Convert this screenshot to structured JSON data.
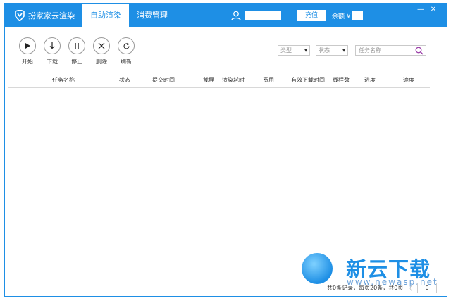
{
  "app": {
    "title": "扮家家云渲染",
    "tabs": [
      {
        "label": "自助渲染",
        "active": true
      },
      {
        "label": "消费管理",
        "active": false
      }
    ],
    "recharge_label": "充值",
    "balance_label": "余额 ¥ :"
  },
  "toolbar": {
    "buttons": [
      {
        "label": "开始",
        "icon": "play-icon"
      },
      {
        "label": "下载",
        "icon": "download-icon"
      },
      {
        "label": "停止",
        "icon": "pause-icon"
      },
      {
        "label": "删除",
        "icon": "close-icon"
      },
      {
        "label": "刷新",
        "icon": "refresh-icon"
      }
    ],
    "filters": {
      "type": "类型",
      "status": "状态",
      "search_placeholder": "任务名称"
    }
  },
  "table": {
    "columns": [
      "任务名称",
      "状态",
      "提交时间",
      "截屏",
      "渲染耗时",
      "费用",
      "有效下载时间",
      "线程数",
      "进度",
      "速度"
    ],
    "rows": []
  },
  "footer": {
    "summary": "共0条记录，每页20条，共0页",
    "page_prev": "〈",
    "page_value": "0"
  },
  "watermark": {
    "text": "新云下载",
    "url": "www.newasp.net"
  },
  "colors": {
    "accent": "#1e8fe5"
  }
}
